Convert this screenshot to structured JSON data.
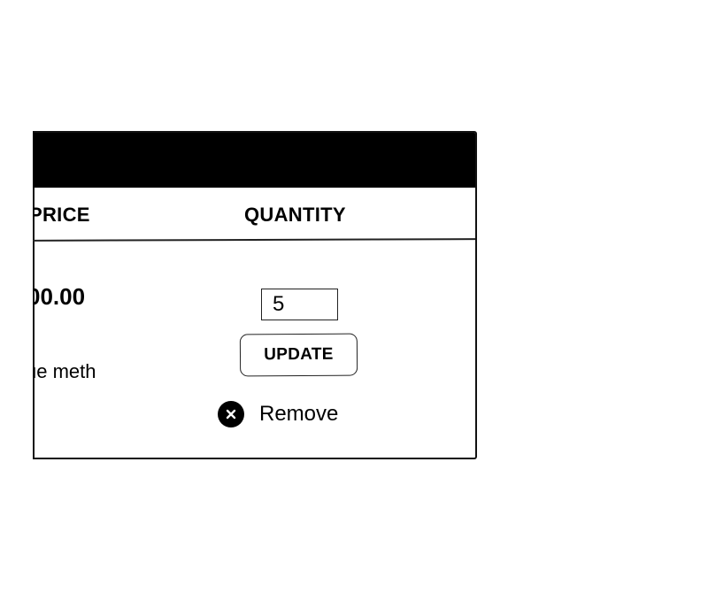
{
  "cart": {
    "columns": {
      "price": "PRICE",
      "quantity": "QUANTITY"
    },
    "item": {
      "price": "00.00",
      "description": "ue meth",
      "quantity_value": "5",
      "update_label": "UPDATE",
      "remove_label": "Remove"
    }
  },
  "icons": {
    "remove": "close-circle-icon"
  }
}
